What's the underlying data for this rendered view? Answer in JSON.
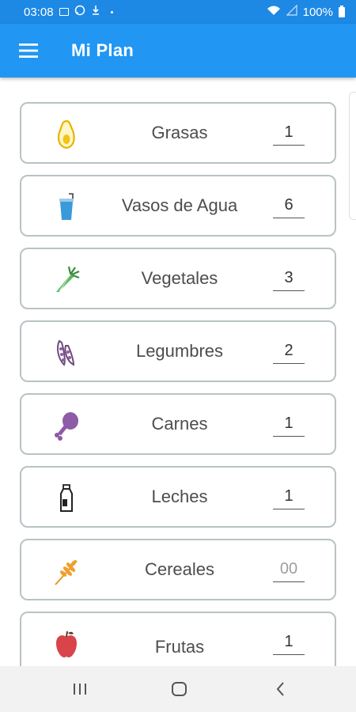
{
  "status_bar": {
    "time": "03:08",
    "battery": "100%"
  },
  "app_bar": {
    "title": "Mi Plan"
  },
  "items": [
    {
      "label": "Grasas",
      "value": "1",
      "icon": "avocado-icon",
      "color": "#f0c419"
    },
    {
      "label": "Vasos de Agua",
      "value": "6",
      "icon": "water-glass-icon",
      "color": "#3a9ad9"
    },
    {
      "label": "Vegetales",
      "value": "3",
      "icon": "carrot-icon",
      "color": "#5cb85c"
    },
    {
      "label": "Legumbres",
      "value": "2",
      "icon": "peapod-icon",
      "color": "#6b4a7a"
    },
    {
      "label": "Carnes",
      "value": "1",
      "icon": "drumstick-icon",
      "color": "#8e5ba6"
    },
    {
      "label": "Leches",
      "value": "1",
      "icon": "milk-bottle-icon",
      "color": "#222222"
    },
    {
      "label": "Cereales",
      "value": "",
      "placeholder": "00",
      "icon": "wheat-icon",
      "color": "#f0a030"
    },
    {
      "label": "Frutas",
      "value": "1",
      "icon": "apple-icon",
      "color": "#d9434a"
    }
  ],
  "nav_bar": {
    "icons": [
      "recent-apps-icon",
      "home-icon",
      "back-icon"
    ]
  }
}
